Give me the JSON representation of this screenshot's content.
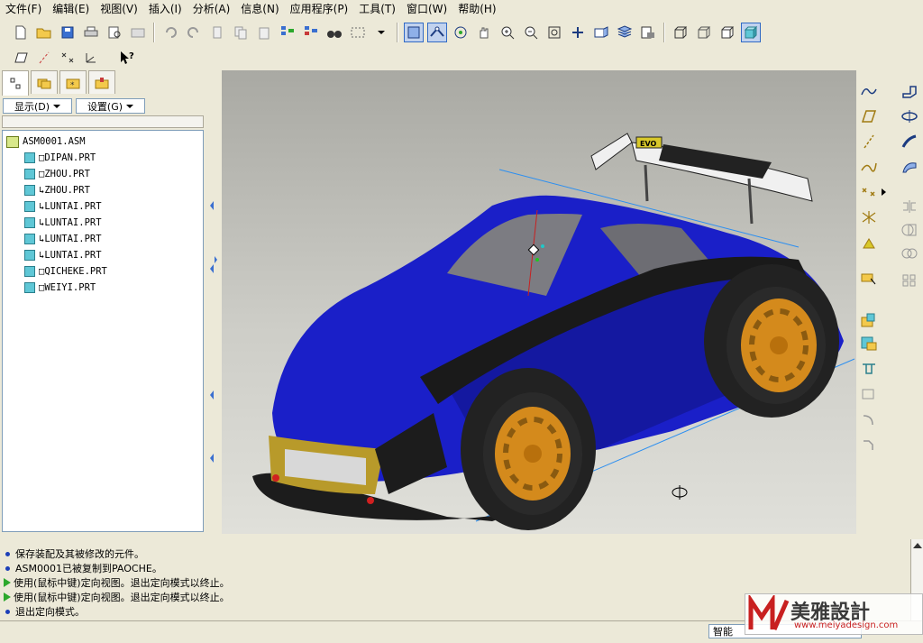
{
  "menu": [
    "文件(F)",
    "编辑(E)",
    "视图(V)",
    "插入(I)",
    "分析(A)",
    "信息(N)",
    "应用程序(P)",
    "工具(T)",
    "窗口(W)",
    "帮助(H)"
  ],
  "left_panel": {
    "show_label": "显示(D)",
    "settings_label": "设置(G)",
    "tree": [
      {
        "name": "ASM0001.ASM",
        "type": "asm"
      },
      {
        "name": "□DIPAN.PRT",
        "type": "part"
      },
      {
        "name": "□ZHOU.PRT",
        "type": "part"
      },
      {
        "name": "↳ZHOU.PRT",
        "type": "part"
      },
      {
        "name": "↳LUNTAI.PRT",
        "type": "part"
      },
      {
        "name": "↳LUNTAI.PRT",
        "type": "part"
      },
      {
        "name": "↳LUNTAI.PRT",
        "type": "part"
      },
      {
        "name": "↳LUNTAI.PRT",
        "type": "part"
      },
      {
        "name": "□QICHEKE.PRT",
        "type": "part"
      },
      {
        "name": "□WEIYI.PRT",
        "type": "part"
      }
    ]
  },
  "messages": [
    {
      "icon": "bullet",
      "text": "保存装配及其被修改的元件。"
    },
    {
      "icon": "bullet",
      "text": "ASM0001已被复制到PAOCHE。"
    },
    {
      "icon": "arrow",
      "text": "使用(鼠标中键)定向视图。退出定向模式以终止。"
    },
    {
      "icon": "arrow",
      "text": "使用(鼠标中键)定向视图。退出定向模式以终止。"
    },
    {
      "icon": "bullet",
      "text": "退出定向模式。"
    }
  ],
  "status": {
    "filter": "智能"
  },
  "watermark": {
    "brand": "美雅設計",
    "url": "www.meiyadesign.com"
  },
  "spoiler_text": "EVO",
  "colors": {
    "car_body": "#1a1fc8",
    "wheel": "#d48a1c",
    "viewport_top": "#a9a9a3"
  }
}
